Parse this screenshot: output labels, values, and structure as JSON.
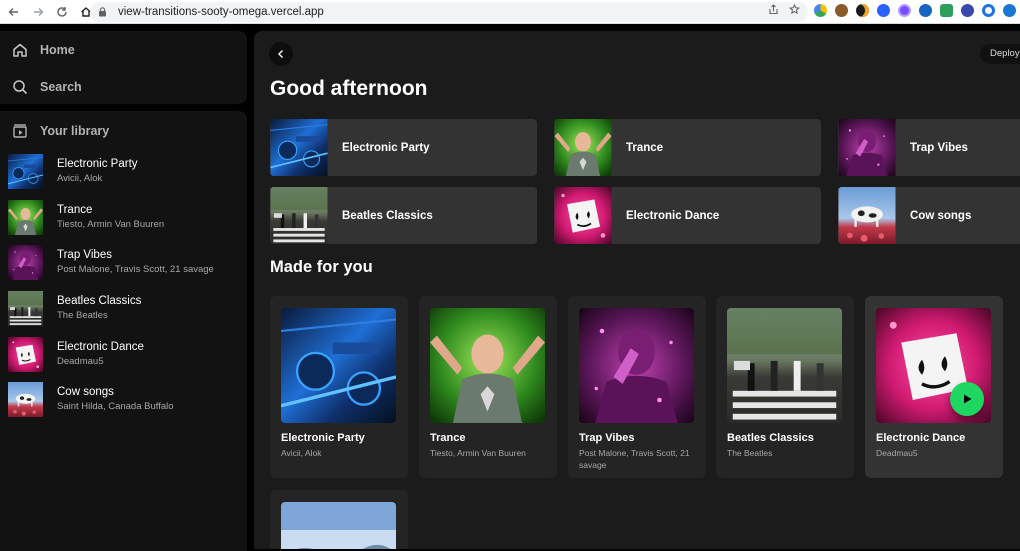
{
  "browser": {
    "url": "view-transitions-sooty-omega.vercel.app"
  },
  "sidebar": {
    "nav": [
      {
        "label": "Home",
        "icon": "home-icon"
      },
      {
        "label": "Search",
        "icon": "search-icon"
      }
    ],
    "library_label": "Your library",
    "library": [
      {
        "title": "Electronic Party",
        "artists": "Avicii, Alok",
        "cover": "electronic-party"
      },
      {
        "title": "Trance",
        "artists": "Tiesto, Armin Van Buuren",
        "cover": "trance"
      },
      {
        "title": "Trap Vibes",
        "artists": "Post Malone, Travis Scott, 21 savage",
        "cover": "trap-vibes"
      },
      {
        "title": "Beatles Classics",
        "artists": "The Beatles",
        "cover": "beatles"
      },
      {
        "title": "Electronic Dance",
        "artists": "Deadmau5",
        "cover": "electronic-dance"
      },
      {
        "title": "Cow songs",
        "artists": "Saint Hilda, Canada Buffalo",
        "cover": "cow-songs"
      }
    ]
  },
  "main": {
    "deploy_label": "Deploy",
    "greeting": "Good afternoon",
    "quick_picks": [
      {
        "label": "Electronic Party"
      },
      {
        "label": "Trance"
      },
      {
        "label": "Trap Vibes"
      },
      {
        "label": "Beatles Classics"
      },
      {
        "label": "Electronic Dance"
      },
      {
        "label": "Cow songs"
      }
    ],
    "section_title": "Made for you",
    "cards": [
      {
        "title": "Electronic Party",
        "artists": "Avicii, Alok"
      },
      {
        "title": "Trance",
        "artists": "Tiesto, Armin Van Buuren"
      },
      {
        "title": "Trap Vibes",
        "artists": "Post Malone, Travis Scott, 21 savage"
      },
      {
        "title": "Beatles Classics",
        "artists": "The Beatles"
      },
      {
        "title": "Electronic Dance",
        "artists": "Deadmau5"
      }
    ]
  },
  "colors": {
    "accent": "#1ed760",
    "sidebar_bg": "#121212",
    "main_bg": "#1b1b1b",
    "card_bg": "#242424"
  }
}
